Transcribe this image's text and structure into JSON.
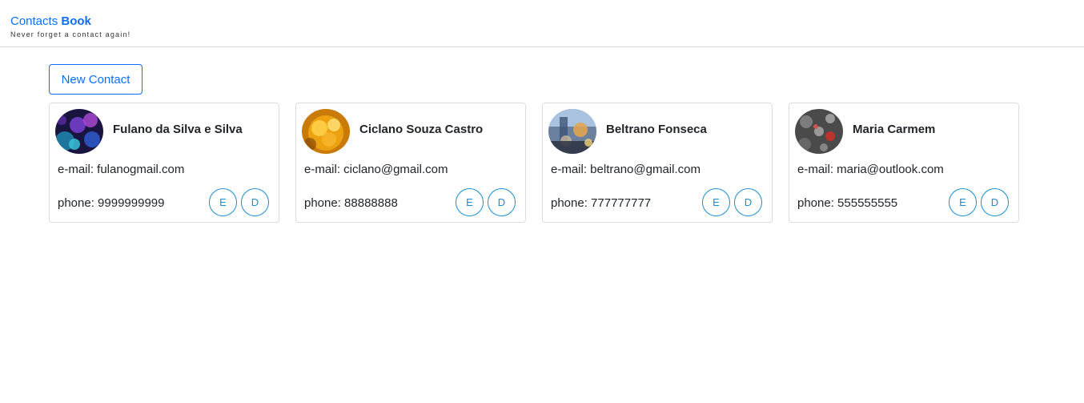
{
  "header": {
    "brand_prefix": "Contacts",
    "brand_bold": "Book",
    "tagline": "Never forget a contact again!"
  },
  "toolbar": {
    "new_contact_label": "New Contact"
  },
  "colors": {
    "accent": "#0d6efd",
    "action_button": "#1a8fd6"
  },
  "contacts": [
    {
      "name": "Fulano da Silva e Silva",
      "email": "e-mail: fulanogmail.com",
      "phone": "phone: 9999999999",
      "edit_label": "E",
      "delete_label": "D"
    },
    {
      "name": "Ciclano Souza Castro",
      "email": "e-mail: ciclano@gmail.com",
      "phone": "phone: 88888888",
      "edit_label": "E",
      "delete_label": "D"
    },
    {
      "name": "Beltrano Fonseca",
      "email": "e-mail: beltrano@gmail.com",
      "phone": "phone: 777777777",
      "edit_label": "E",
      "delete_label": "D"
    },
    {
      "name": "Maria Carmem",
      "email": "e-mail: maria@outlook.com",
      "phone": "phone: 555555555",
      "edit_label": "E",
      "delete_label": "D"
    }
  ]
}
